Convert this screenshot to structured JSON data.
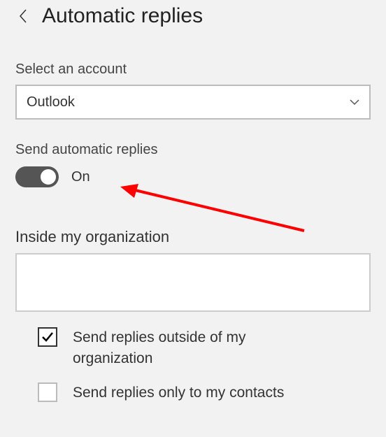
{
  "header": {
    "title": "Automatic replies"
  },
  "account": {
    "label": "Select an account",
    "selected": "Outlook"
  },
  "autoReply": {
    "label": "Send automatic replies",
    "toggleState": "On"
  },
  "inside": {
    "label": "Inside my organization",
    "value": ""
  },
  "options": {
    "outside": "Send replies outside of my organization",
    "contactsOnly": "Send replies only to my contacts"
  }
}
